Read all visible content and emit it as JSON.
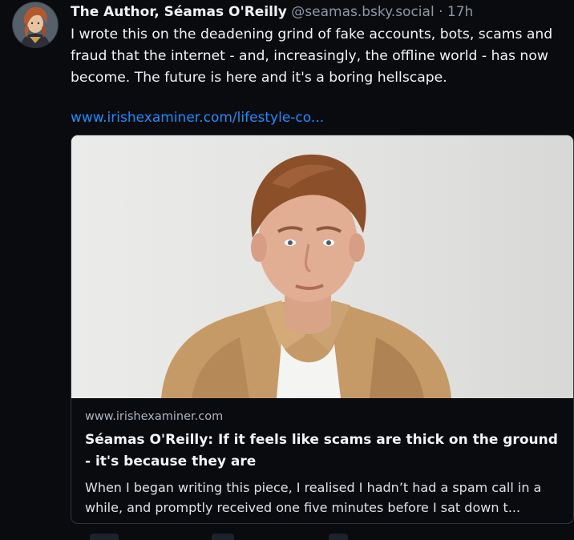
{
  "post": {
    "author_name": "The Author, Séamas O'Reilly",
    "handle": "@seamas.bsky.social",
    "separator": "·",
    "time": "17h",
    "text": "I wrote this on the deadening grind of fake accounts, bots, scams and fraud that the internet - and, increasingly, the offline world - has now become. The future is here and it's a boring hellscape.",
    "link_text": "www.irishexaminer.com/lifestyle-co..."
  },
  "embed": {
    "domain": "www.irishexaminer.com",
    "title": "Séamas O'Reilly: If it feels like scams are thick on the ground - it's because they are",
    "description": "When I began writing this piece, I realised I hadn’t had a spam call in a while, and promptly received one five minutes before I sat down t..."
  },
  "colors": {
    "background": "#0a0b0e",
    "text": "#f1f3f5",
    "muted": "#8d98a5",
    "link": "#208bfe",
    "card_border": "#2e3540"
  }
}
